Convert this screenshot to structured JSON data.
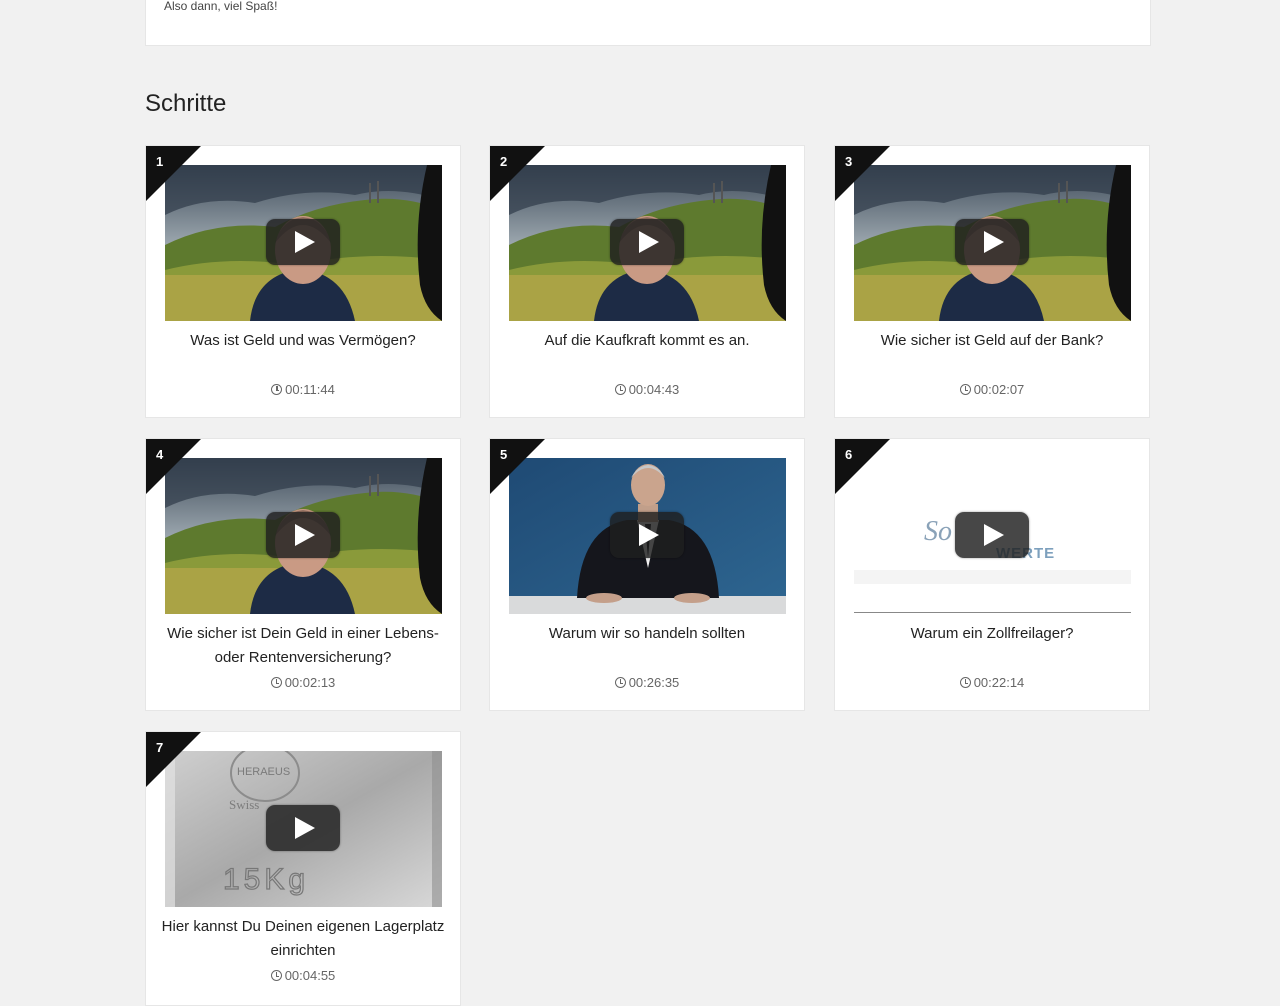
{
  "intro": {
    "text": "Also dann, viel Spaß!"
  },
  "section": {
    "title": "Schritte"
  },
  "steps": [
    {
      "number": "1",
      "title": "Was ist Geld und was Vermögen?",
      "duration": "00:11:44",
      "thumbnail": "landscape-speaker"
    },
    {
      "number": "2",
      "title": "Auf die Kaufkraft kommt es an.",
      "duration": "00:04:43",
      "thumbnail": "landscape-speaker"
    },
    {
      "number": "3",
      "title": "Wie sicher ist Geld auf der Bank?",
      "duration": "00:02:07",
      "thumbnail": "landscape-speaker"
    },
    {
      "number": "4",
      "title": "Wie sicher ist Dein Geld in einer Lebens- oder Rentenversicherung?",
      "duration": "00:02:13",
      "thumbnail": "landscape-speaker"
    },
    {
      "number": "5",
      "title": "Warum wir so handeln sollten",
      "duration": "00:26:35",
      "thumbnail": "studio-speaker"
    },
    {
      "number": "6",
      "title": "Warum ein Zollfreilager?",
      "duration": "00:22:14",
      "thumbnail": "logo-slide",
      "logo_text_left": "So",
      "logo_text_right": "WERTE"
    },
    {
      "number": "7",
      "title": "Hier kannst Du Deinen eigenen Lagerplatz einrichten",
      "duration": "00:04:55",
      "thumbnail": "silver-bar",
      "bar_text_top": "HERAEUS",
      "bar_text_mid": "Swiss",
      "bar_text_weight": "15Kg"
    }
  ],
  "colors": {
    "ribbon": "#111111",
    "page_bg": "#f1f1f1",
    "card_bg": "#ffffff"
  },
  "icons": {
    "play": "play-button-icon",
    "duration": "clock-icon"
  }
}
